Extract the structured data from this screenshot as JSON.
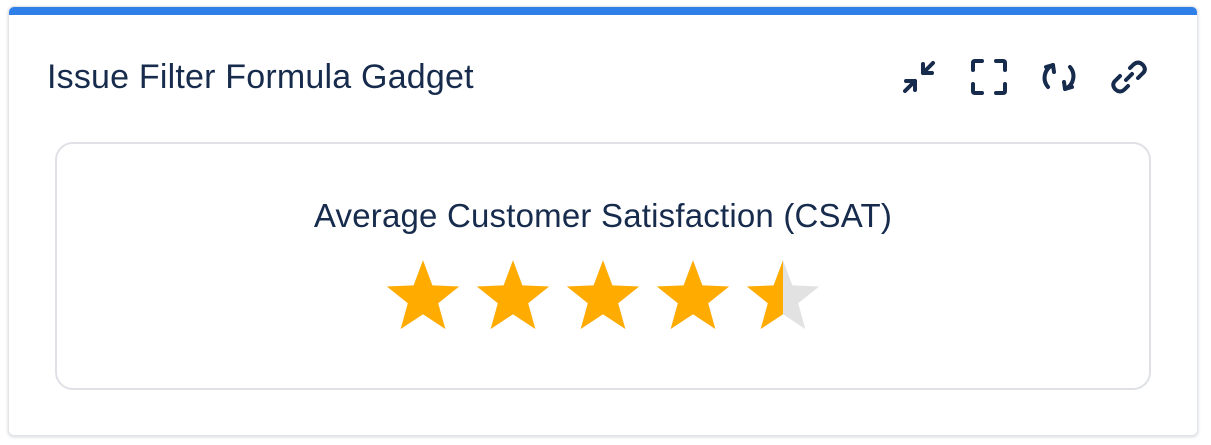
{
  "gadget": {
    "title": "Issue Filter Formula Gadget",
    "accent_color": "#2f7fe9",
    "toolbar": [
      {
        "name": "minimize-icon",
        "label": "minimize"
      },
      {
        "name": "fullscreen-icon",
        "label": "fullscreen"
      },
      {
        "name": "refresh-icon",
        "label": "refresh"
      },
      {
        "name": "link-icon",
        "label": "link"
      }
    ]
  },
  "metric": {
    "title": "Average Customer Satisfaction (CSAT)",
    "rating": 4.5,
    "max_rating": 5,
    "star_color": "#ffab00",
    "empty_star_color": "#e2e2e2"
  }
}
